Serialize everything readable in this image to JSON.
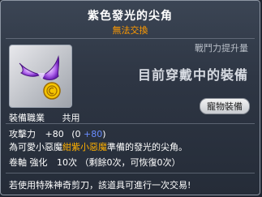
{
  "item": {
    "name": "紫色發光的尖角",
    "trade_status": "無法交換",
    "power_label": "戰鬥力提升量",
    "equipped_notice": "目前穿戴中的裝備",
    "job_req_label": "裝備職業",
    "job_req_value": "共用",
    "pet_equip_button": "寵物裝備",
    "stat": {
      "label": "攻擊力",
      "total": "+80",
      "base_open": "(0",
      "bonus": "+80",
      "close": ")"
    },
    "description": {
      "prefix": "為可愛小惡魔",
      "highlight": "紺紫小惡魔",
      "suffix": "準備的發光的尖角。"
    },
    "scroll": {
      "label": "卷軸 強化",
      "count": "10次",
      "remaining": "（剩餘0次，可恢復0次）"
    },
    "scissors_note": "若使用特殊神奇剪刀，該道具可進行一次交易!"
  },
  "colors": {
    "title": "#ffffff",
    "trade_status": "#ff9a00",
    "highlight": "#ffb000",
    "bonus": "#6a8dff",
    "icon_primary": "#8b3fd6",
    "icon_coin": "#f5c400"
  },
  "icons": {
    "item_icon": "purple-glowing-horn-icon",
    "coin_badge": "gold-coin-icon"
  }
}
